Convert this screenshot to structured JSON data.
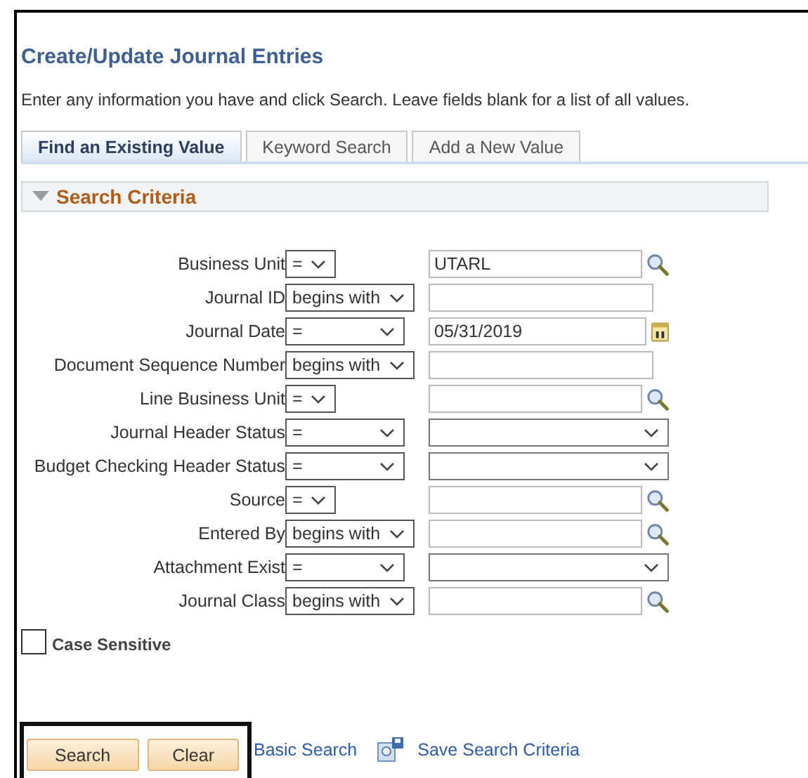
{
  "page_title": "Create/Update Journal Entries",
  "instructions": "Enter any information you have and click Search. Leave fields blank for a list of all values.",
  "tabs": [
    {
      "label": "Find an Existing Value",
      "selected": true
    },
    {
      "label": "Keyword Search",
      "selected": false
    },
    {
      "label": "Add a New Value",
      "selected": false
    }
  ],
  "section": {
    "title": "Search Criteria",
    "expanded": true
  },
  "criteria": [
    {
      "label": "Business Unit",
      "operator": "=",
      "kind": "lookup",
      "value": "UTARL"
    },
    {
      "label": "Journal ID",
      "operator": "begins with",
      "kind": "text"
    },
    {
      "label": "Journal Date",
      "operator": "=",
      "kind": "date",
      "value": "05/31/2019"
    },
    {
      "label": "Document Sequence Number",
      "operator": "begins with",
      "kind": "text"
    },
    {
      "label": "Line Business Unit",
      "operator": "=",
      "kind": "lookup"
    },
    {
      "label": "Journal Header Status",
      "operator": "=",
      "kind": "dropdown"
    },
    {
      "label": "Budget Checking Header Status",
      "operator": "=",
      "kind": "dropdown"
    },
    {
      "label": "Source",
      "operator": "=",
      "kind": "lookup"
    },
    {
      "label": "Entered By",
      "operator": "begins with",
      "kind": "lookup"
    },
    {
      "label": "Attachment Exist",
      "operator": "=",
      "kind": "dropdown"
    },
    {
      "label": "Journal Class",
      "operator": "begins with",
      "kind": "lookup"
    }
  ],
  "case_sensitive": {
    "label": "Case Sensitive",
    "checked": false
  },
  "buttons": [
    "Search",
    "Clear"
  ],
  "links": [
    "Basic Search",
    "Save Search Criteria"
  ]
}
